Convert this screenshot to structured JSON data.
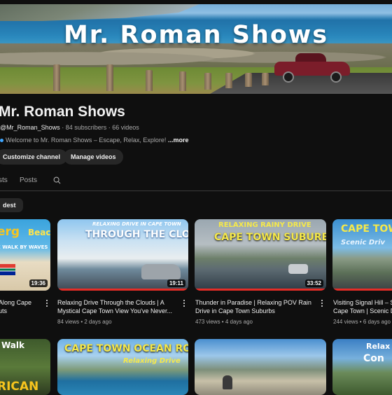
{
  "banner": {
    "title": "Mr. Roman Shows"
  },
  "channel": {
    "name": "Mr. Roman Shows",
    "handle": "@Mr_Roman_Shows",
    "subscribers": "84 subscribers",
    "videos": "66 videos",
    "description": "Welcome to Mr. Roman Shows – Escape, Relax, Explore!",
    "more": "...more"
  },
  "buttons": {
    "customize": "Customize channel",
    "manage": "Manage videos"
  },
  "tabs": [
    "sts",
    "Posts"
  ],
  "chip": "dest",
  "videos": [
    {
      "overlay_top": "erg",
      "overlay_top2": "Beach",
      "overlay_sub": "E WALK BY WAVES",
      "duration": "19:36",
      "title_l1": "Along Cape",
      "title_l2": "uts",
      "views": "",
      "age": ""
    },
    {
      "overlay_top": "RELAXING DRIVE IN CAPE TOWN",
      "overlay_sub": "THROUGH THE CLOUDS",
      "duration": "19:11",
      "title_l1": "Relaxing Drive Through the Clouds | A",
      "title_l2": "Mystical Cape Town View You've Never...",
      "views": "84 views",
      "age": "2 days ago"
    },
    {
      "overlay_top": "RELAXING RAINY DRIVE",
      "overlay_sub": "CAPE TOWN SUBURBS",
      "duration": "33:52",
      "title_l1": "Thunder in Paradise | Relaxing POV Rain",
      "title_l2": "Drive in Cape Town Suburbs",
      "views": "473 views",
      "age": "4 days ago"
    },
    {
      "overlay_top": "CAPE TOWN",
      "overlay_sub": "Scenic Driv",
      "duration": "",
      "title_l1": "Visiting Signal Hill – Sce",
      "title_l2": "Cape Town | Scenic Dri",
      "views": "244 views",
      "age": "6 days ago"
    }
  ],
  "row2": [
    {
      "overlay_top": "Walk",
      "overlay_sub": "RICAN"
    },
    {
      "overlay_top": "CAPE TOWN OCEAN ROUTE",
      "overlay_sub": "Relaxing Drive"
    },
    {
      "overlay_top": "",
      "overlay_sub": ""
    },
    {
      "overlay_top": "Relax",
      "overlay_sub": "Con"
    }
  ],
  "colors": {
    "background": "#0f0f0f",
    "progress": "#e52d27",
    "chip_bg": "#272727"
  }
}
